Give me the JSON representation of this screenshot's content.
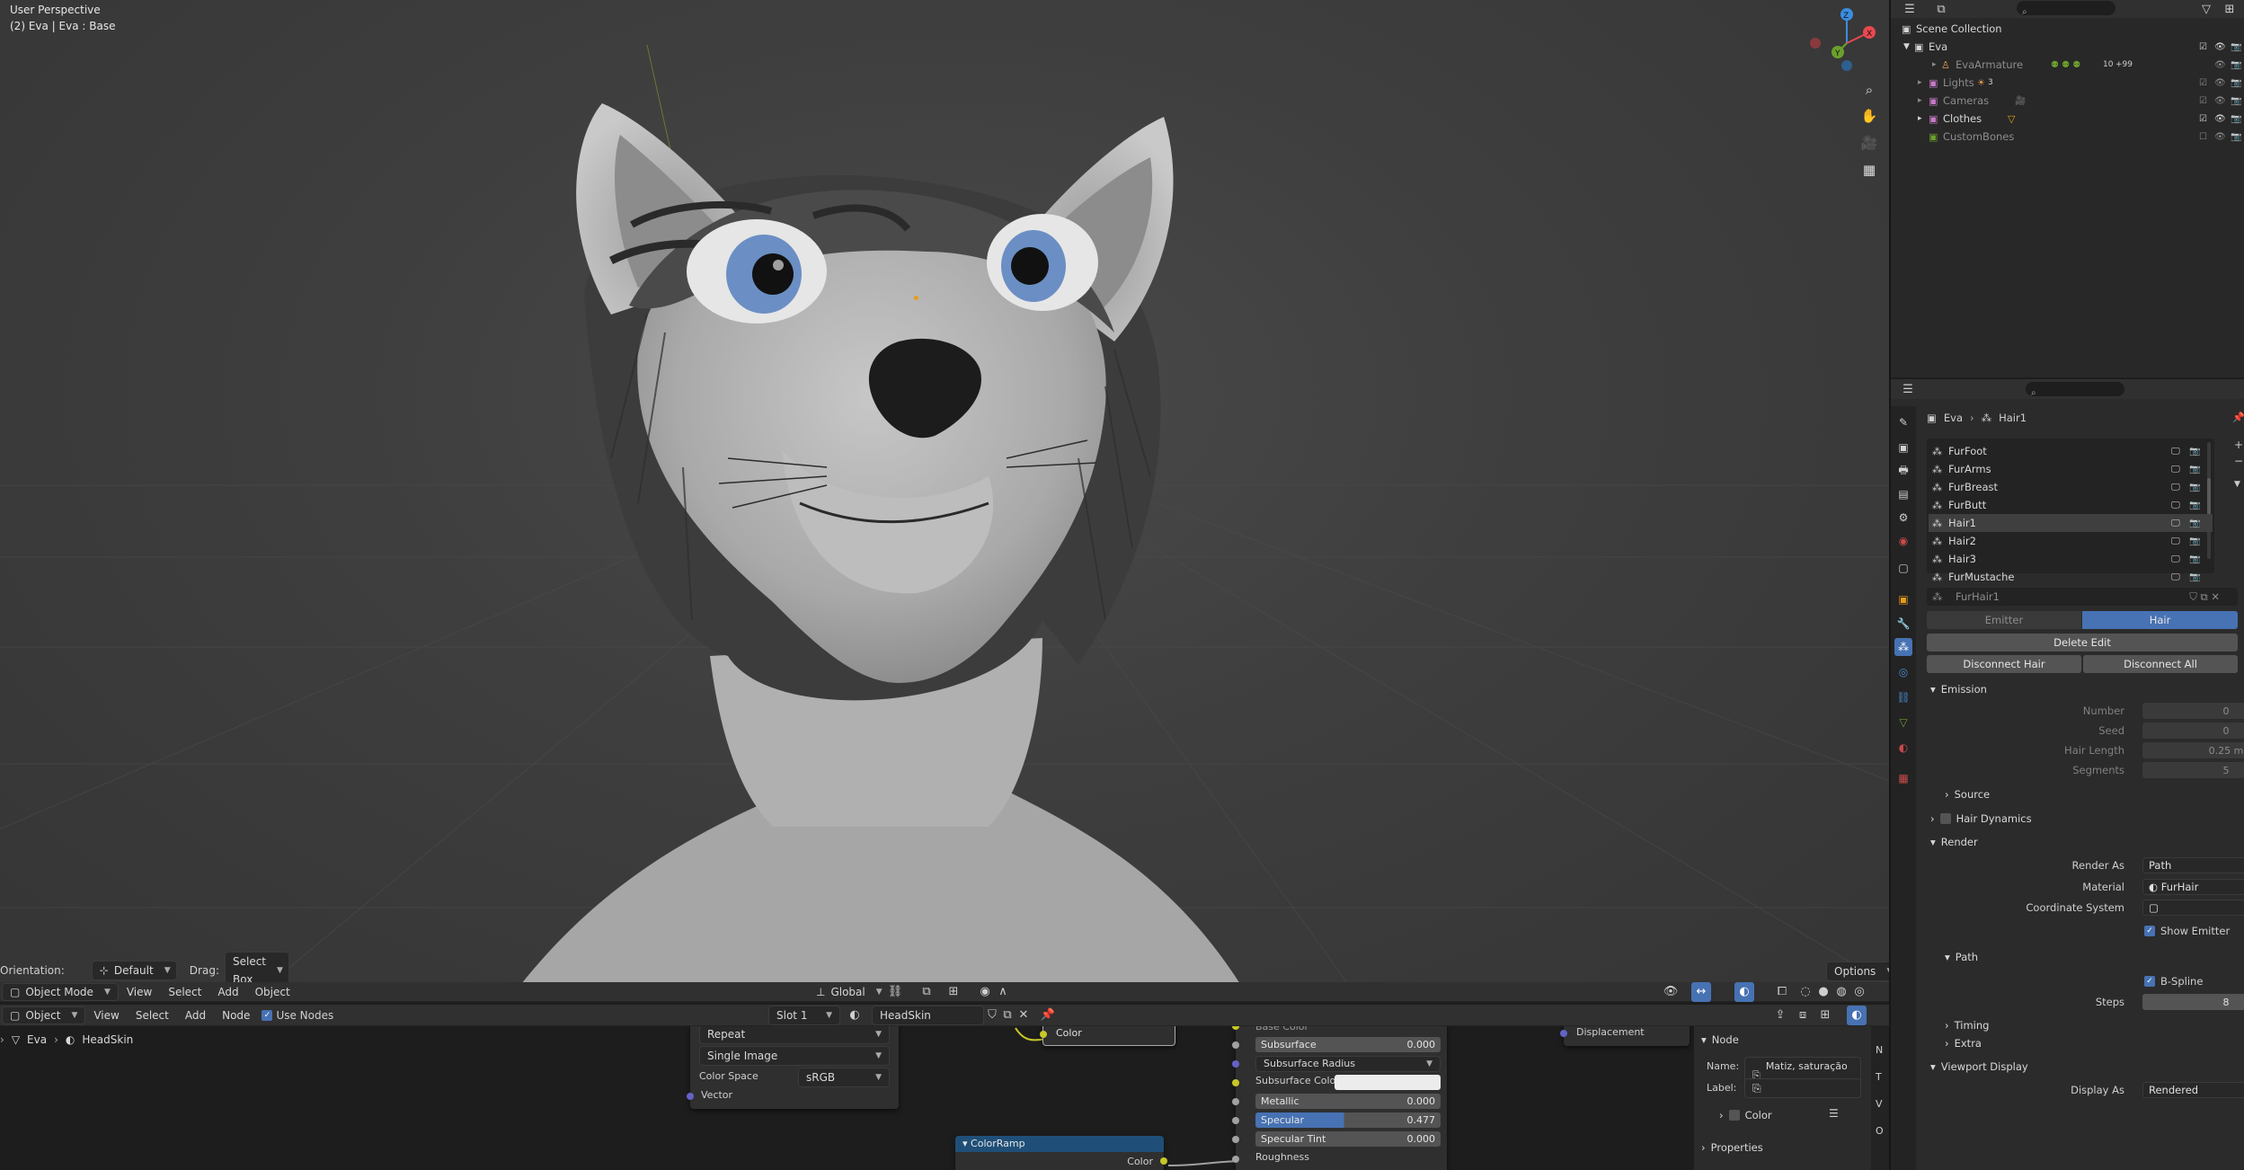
{
  "viewport": {
    "perspective": "User Perspective",
    "object_info": "(2) Eva | Eva : Base",
    "header": {
      "orientation_label": "Orientation:",
      "orientation_value": "Default",
      "drag_label": "Drag:",
      "drag_value": "Select Box",
      "options": "Options"
    },
    "menu": {
      "mode": "Object Mode",
      "items": [
        "View",
        "Select",
        "Add",
        "Object"
      ],
      "transform": "Global"
    },
    "gizmo": {
      "x": "X",
      "y": "Y",
      "z": "Z"
    }
  },
  "node_editor": {
    "header": {
      "type": "Object",
      "items": [
        "View",
        "Select",
        "Add",
        "Node"
      ],
      "use_nodes": "Use Nodes",
      "slot": "Slot 1",
      "material": "HeadSkin"
    },
    "breadcrumb": [
      "Eva",
      "HeadSkin"
    ],
    "image_node": {
      "extension": "Repeat",
      "source": "Single Image",
      "color_space_label": "Color Space",
      "color_space_value": "sRGB",
      "vector": "Vector"
    },
    "color_node_out": "Color",
    "colorramp": {
      "title": "ColorRamp",
      "output": "Color"
    },
    "bsdf": {
      "base_color": "Base Color",
      "subsurface_label": "Subsurface",
      "subsurface_value": "0.000",
      "subsurface_radius": "Subsurface Radius",
      "subsurface_color": "Subsurface Colo",
      "metallic_label": "Metallic",
      "metallic_value": "0.000",
      "specular_label": "Specular",
      "specular_value": "0.477",
      "specular_tint_label": "Specular Tint",
      "specular_tint_value": "0.000",
      "roughness": "Roughness"
    },
    "output_node": {
      "displacement": "Displacement"
    },
    "sidebar": {
      "node_header": "Node",
      "name_label": "Name:",
      "name_value": "Matiz, saturação ...",
      "label_label": "Label:",
      "color": "Color",
      "properties": "Properties",
      "tabs": [
        "N",
        "T",
        "V",
        "O"
      ]
    }
  },
  "outliner": {
    "title": "Scene Collection",
    "rows": [
      {
        "label": "Eva"
      },
      {
        "label": "EvaArmature",
        "badge": "10",
        "extra": "+99"
      },
      {
        "label": "Lights",
        "badge": "3"
      },
      {
        "label": "Cameras"
      },
      {
        "label": "Clothes"
      },
      {
        "label": "CustomBones"
      }
    ]
  },
  "properties": {
    "breadcrumb": [
      "Eva",
      "Hair1"
    ],
    "particle_systems": [
      "FurFoot",
      "FurArms",
      "FurBreast",
      "FurButt",
      "Hair1",
      "Hair2",
      "Hair3",
      "FurMustache"
    ],
    "settings_name": "FurHair1",
    "type_tabs": [
      "Emitter",
      "Hair"
    ],
    "buttons": {
      "delete_edit": "Delete Edit",
      "disconnect_hair": "Disconnect Hair",
      "disconnect_all": "Disconnect All"
    },
    "emission": {
      "title": "Emission",
      "number_label": "Number",
      "number_value": "0",
      "seed_label": "Seed",
      "seed_value": "0",
      "hair_length_label": "Hair Length",
      "hair_length_value": "0.25 m",
      "segments_label": "Segments",
      "segments_value": "5",
      "source": "Source"
    },
    "hair_dynamics": "Hair Dynamics",
    "render": {
      "title": "Render",
      "render_as_label": "Render As",
      "render_as_value": "Path",
      "material_label": "Material",
      "material_value": "FurHair",
      "coord_label": "Coordinate System",
      "show_emitter": "Show Emitter",
      "path": "Path",
      "bspline": "B-Spline",
      "steps_label": "Steps",
      "steps_value": "8",
      "timing": "Timing",
      "extra": "Extra"
    },
    "viewport_display": {
      "title": "Viewport Display",
      "display_as_label": "Display As",
      "display_as_value": "Rendered"
    }
  },
  "colors": {
    "accent": "#4772b3",
    "x_axis": "#e8484f",
    "y_axis": "#6ba02c",
    "z_axis": "#3a8de0"
  }
}
